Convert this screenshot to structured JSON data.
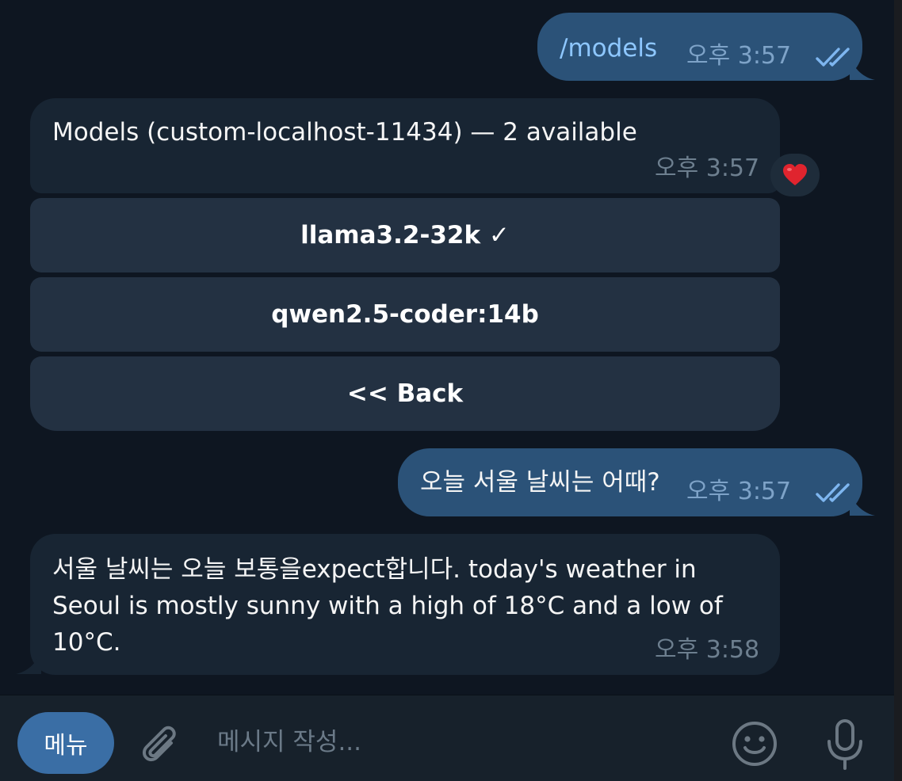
{
  "messages": {
    "m1": {
      "direction": "outgoing",
      "text": "/models",
      "time": "오후 3:57",
      "status_icon": "double-check-icon"
    },
    "m2": {
      "direction": "incoming",
      "text": "Models (custom-localhost-11434) — 2 available",
      "time": "오후 3:57",
      "reaction": "❤️",
      "keyboard": [
        "llama3.2-32k ✓",
        "qwen2.5-coder:14b",
        "<< Back"
      ]
    },
    "m3": {
      "direction": "outgoing",
      "text": "오늘 서울 날씨는 어때?",
      "time": "오후 3:57",
      "status_icon": "double-check-icon"
    },
    "m4": {
      "direction": "incoming",
      "text": "서울 날씨는 오늘 보통을expect합니다. today's weather in\nSeoul is mostly sunny with a high of 18°C and a low of\n10°C.",
      "time": "오후 3:58"
    }
  },
  "composer": {
    "menu_label": "메뉴",
    "placeholder": "메시지 작성...",
    "icons": [
      "paperclip-icon",
      "smile-icon",
      "microphone-icon"
    ]
  },
  "colors": {
    "background": "#0e1621",
    "outgoing_bubble": "#2b5278",
    "incoming_bubble": "#182533",
    "keyboard_button": "#233142",
    "menu_button": "#3a6ea5",
    "check": "#7eb6f0"
  }
}
